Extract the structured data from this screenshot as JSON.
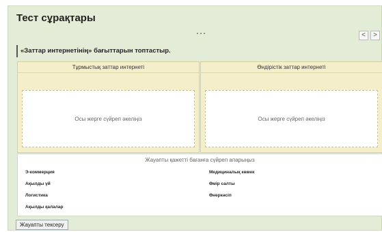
{
  "title": "Тест сұрақтары",
  "nav": {
    "prev_icon": "<",
    "next_icon": ">"
  },
  "question": "«Заттар интернетінің» бағыттарын топтастыр.",
  "columns": [
    {
      "header": "Тұрмыстық заттар интернеті",
      "dropzone": "Осы жерге сүйреп әкеліңіз"
    },
    {
      "header": "Өндірістік заттар интернеті",
      "dropzone": "Осы жерге сүйреп әкеліңіз"
    }
  ],
  "answers": {
    "header": "Жауапты қажетті бағанға сүйреп апарыңыз",
    "items": [
      "Э-коммерция",
      "Ақылды үй",
      "Логистика",
      "Ақылды қалалар",
      "Медициналық көмек",
      "Өмір салты",
      "Өнеркәсіп"
    ]
  },
  "check_button": "Жауапты тексеру"
}
